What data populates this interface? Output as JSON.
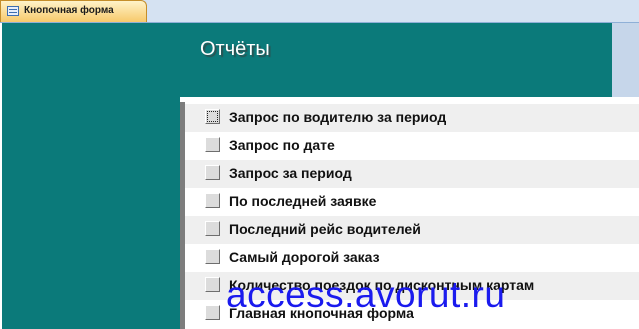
{
  "tab": {
    "label": "Кнопочная форма",
    "icon": "form-icon"
  },
  "form": {
    "title": "Отчёты"
  },
  "menu": {
    "items": [
      {
        "label": "Запрос по водителю за период"
      },
      {
        "label": "Запрос по дате"
      },
      {
        "label": "Запрос за период"
      },
      {
        "label": "По последней заявке"
      },
      {
        "label": "Последний рейс водителей"
      },
      {
        "label": "Самый дорогой заказ"
      },
      {
        "label": "Количество поездок по дисконтным картам"
      },
      {
        "label": "Главная кнопочная форма"
      }
    ]
  },
  "watermark": {
    "text": "access.avorut.ru"
  },
  "colors": {
    "header": "#0b7a7a",
    "tab_active": "#f7c96b",
    "watermark": "#1a1aee"
  }
}
